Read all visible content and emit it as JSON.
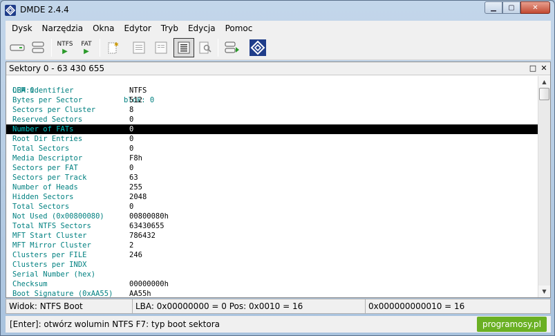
{
  "window": {
    "title": "DMDE 2.4.4"
  },
  "menu": [
    "Dysk",
    "Narzędzia",
    "Okna",
    "Edytor",
    "Tryb",
    "Edycja",
    "Pomoc"
  ],
  "toolbar": {
    "ntfs_label": "NTFS",
    "fat_label": "FAT"
  },
  "panel": {
    "title": "Sektory 0 - 63 430 655"
  },
  "header_row": {
    "lba": "LBA:0",
    "block": "blok: 0"
  },
  "rows": [
    {
      "label": "OEM identifier",
      "value": "NTFS"
    },
    {
      "label": "Bytes per Sector",
      "value": "512"
    },
    {
      "label": "Sectors per Cluster",
      "value": "8"
    },
    {
      "label": "Reserved Sectors",
      "value": "0"
    },
    {
      "label": "Number of FATs",
      "value": "0",
      "selected": true
    },
    {
      "label": "Root Dir Entries",
      "value": "0"
    },
    {
      "label": "Total Sectors",
      "value": "0"
    },
    {
      "label": "Media Descriptor",
      "value": "F8h"
    },
    {
      "label": "Sectors per FAT",
      "value": "0"
    },
    {
      "label": "Sectors per Track",
      "value": "63"
    },
    {
      "label": "Number of Heads",
      "value": "255"
    },
    {
      "label": "Hidden Sectors",
      "value": "2048"
    },
    {
      "label": "Total Sectors",
      "value": "0"
    },
    {
      "label": "Not Used (0x00800080)",
      "value": "00800080h"
    },
    {
      "label": "Total NTFS Sectors",
      "value": "63430655"
    },
    {
      "label": "MFT Start Cluster",
      "value": "786432"
    },
    {
      "label": "MFT Mirror Cluster",
      "value": "2"
    },
    {
      "label": "Clusters per FILE",
      "value": "246"
    },
    {
      "label": "Clusters per INDX",
      "value": ""
    },
    {
      "label": "Serial Number (hex)",
      "value": ""
    },
    {
      "label": "Checksum",
      "value": "00000000h"
    },
    {
      "label": "Boot Signature (0xAA55)",
      "value": "AA55h"
    }
  ],
  "status": {
    "view": "Widok: NTFS Boot",
    "position": "LBA: 0x00000000 = 0  Pos: 0x0010 = 16",
    "offset": "0x000000000010 = 16"
  },
  "hint": "[Enter]: otwórz wolumin NTFS   F7: typ boot sektora",
  "watermark": "programosy.pl",
  "colors": {
    "label": "#008080",
    "selection": "#000000",
    "watermark": "#6ab023"
  }
}
